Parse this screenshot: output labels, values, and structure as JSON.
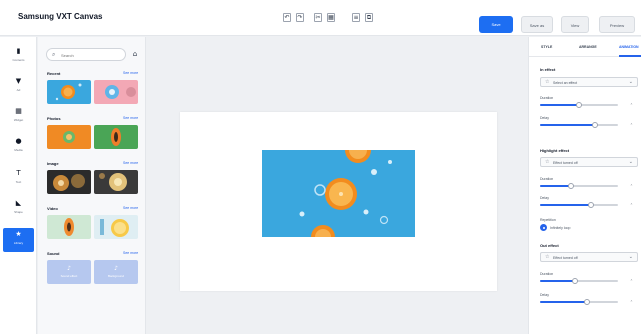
{
  "app": {
    "title": "Samsung VXT Canvas"
  },
  "toolbar": {
    "tools": [
      {
        "icon": "undo-icon",
        "glyph": "↶"
      },
      {
        "icon": "redo-icon",
        "glyph": "↷"
      },
      {
        "icon": "cut-icon",
        "glyph": "✂"
      },
      {
        "icon": "grid-icon",
        "glyph": "▦"
      },
      {
        "icon": "align-icon",
        "glyph": "≡"
      },
      {
        "icon": "arrange-icon",
        "glyph": "⧉"
      }
    ],
    "primary_label": "Save",
    "secondary_label": "Save as",
    "tertiary_label": "View",
    "quaternary_label": "Preview"
  },
  "rail": {
    "items": [
      {
        "name": "content",
        "label": "Contents",
        "glyph": "▮",
        "icon": "content-icon",
        "active": false
      },
      {
        "name": "ad",
        "label": "Ad",
        "glyph": "▼",
        "icon": "ad-icon",
        "active": false
      },
      {
        "name": "widget",
        "label": "Widget",
        "glyph": "▦",
        "icon": "widget-icon",
        "active": false
      },
      {
        "name": "media",
        "label": "Media",
        "glyph": "●",
        "icon": "media-icon",
        "active": false
      },
      {
        "name": "text",
        "label": "Text",
        "glyph": "T",
        "icon": "text-icon",
        "active": false
      },
      {
        "name": "shape",
        "label": "Shape",
        "glyph": "◣",
        "icon": "shape-icon",
        "active": false
      },
      {
        "name": "library",
        "label": "Library",
        "glyph": "★",
        "icon": "library-icon",
        "active": true
      }
    ]
  },
  "assets": {
    "search_placeholder": "Search",
    "sections": [
      {
        "title": "Recent",
        "link": "See more"
      },
      {
        "title": "Photos",
        "link": "See more"
      },
      {
        "title": "Image",
        "link": "See more"
      },
      {
        "title": "Video",
        "link": "See more"
      },
      {
        "title": "Sound",
        "link": "See more"
      }
    ],
    "sound_tiles": [
      "Sound effect",
      "Background"
    ]
  },
  "inspector": {
    "tabs": [
      {
        "label": "STYLE",
        "active": false
      },
      {
        "label": "ARRANGE",
        "active": false
      },
      {
        "label": "ANIMATION",
        "active": true
      }
    ],
    "in_effect": {
      "label": "In effect",
      "select_value": "Select an effect"
    },
    "in_duration_label": "Duration",
    "in_delay_label": "Delay",
    "highlight_effect": {
      "label": "Highlight effect",
      "select_value": "Effect turned off"
    },
    "highlight_duration_label": "Duration",
    "highlight_delay_label": "Delay",
    "repetition": {
      "label": "Repetition",
      "option": "Infinitely loop"
    },
    "out_effect": {
      "label": "Out effect",
      "select_value": "Effect turned off"
    },
    "out_duration_label": "Duration",
    "out_delay_label": "Delay",
    "sliders": {
      "in_duration": 0.5,
      "in_delay": 0.7,
      "highlight_duration": 0.4,
      "highlight_delay": 0.65,
      "out_duration": 0.45,
      "out_delay": 0.6
    }
  },
  "colors": {
    "accent": "#1d6ef2",
    "photo_blue": "#3aa7de",
    "orange": "#f28c1e"
  }
}
